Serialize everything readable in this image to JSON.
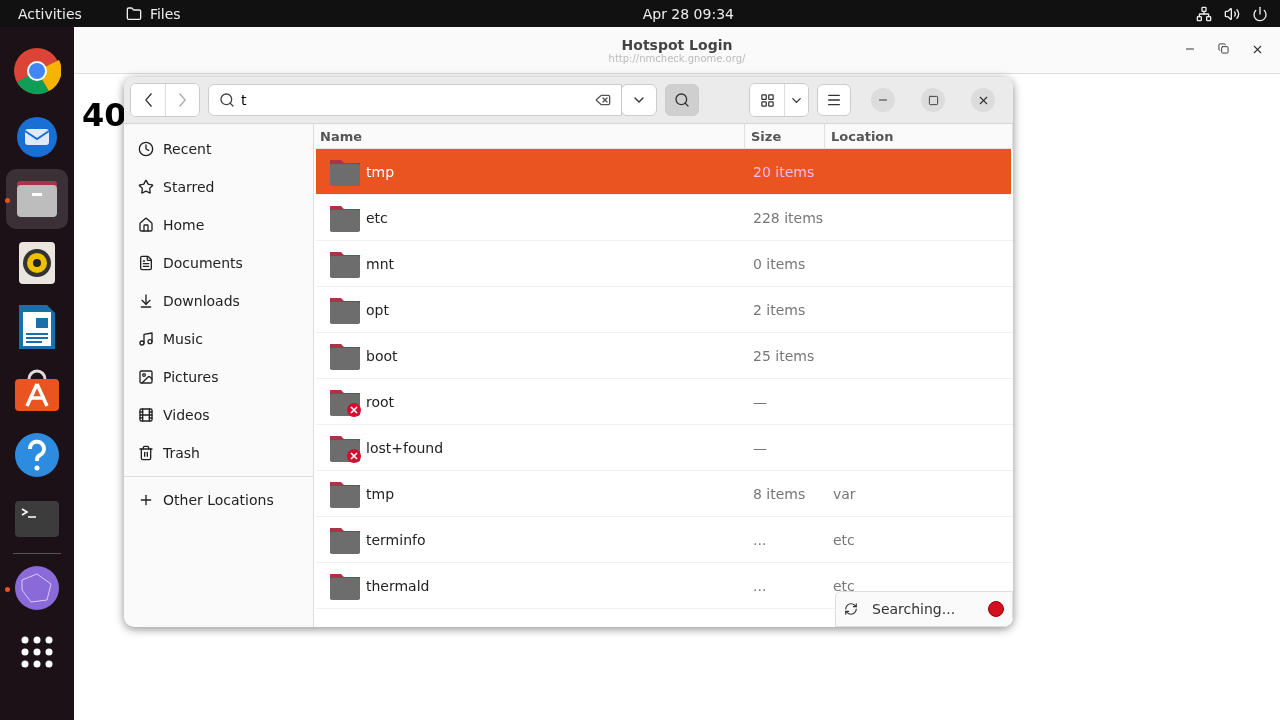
{
  "top_bar": {
    "activities": "Activities",
    "app": "Files",
    "clock": "Apr 28  09:34"
  },
  "dock": [
    {
      "kind": "chrome",
      "running": false,
      "active": false
    },
    {
      "kind": "mail",
      "running": false,
      "active": false
    },
    {
      "kind": "files",
      "running": true,
      "active": true
    },
    {
      "kind": "audio",
      "running": false,
      "active": false
    },
    {
      "kind": "writer",
      "running": false,
      "active": false
    },
    {
      "kind": "store",
      "running": false,
      "active": false
    },
    {
      "kind": "help",
      "running": false,
      "active": false
    },
    {
      "kind": "terminal",
      "running": false,
      "active": false
    },
    {
      "kind": "network",
      "running": true,
      "active": false
    },
    {
      "kind": "apps",
      "running": false,
      "active": false
    }
  ],
  "browser": {
    "title": "Hotspot Login",
    "url": "http://nmcheck.gnome.org/",
    "content": "40"
  },
  "files": {
    "search": {
      "value": "t"
    },
    "sidebar": {
      "items": [
        {
          "kind": "recent",
          "label": "Recent"
        },
        {
          "kind": "starred",
          "label": "Starred"
        },
        {
          "kind": "home",
          "label": "Home"
        },
        {
          "kind": "documents",
          "label": "Documents"
        },
        {
          "kind": "downloads",
          "label": "Downloads"
        },
        {
          "kind": "music",
          "label": "Music"
        },
        {
          "kind": "pictures",
          "label": "Pictures"
        },
        {
          "kind": "videos",
          "label": "Videos"
        },
        {
          "kind": "trash",
          "label": "Trash"
        }
      ],
      "other": {
        "label": "Other Locations"
      }
    },
    "table": {
      "columns": [
        "Name",
        "Size",
        "Location"
      ],
      "rows": [
        {
          "name": "tmp",
          "size": "20 items",
          "location": "",
          "selected": true,
          "locked": false
        },
        {
          "name": "etc",
          "size": "228 items",
          "location": "",
          "selected": false,
          "locked": false
        },
        {
          "name": "mnt",
          "size": "0 items",
          "location": "",
          "selected": false,
          "locked": false
        },
        {
          "name": "opt",
          "size": "2 items",
          "location": "",
          "selected": false,
          "locked": false
        },
        {
          "name": "boot",
          "size": "25 items",
          "location": "",
          "selected": false,
          "locked": false
        },
        {
          "name": "root",
          "size": "—",
          "location": "",
          "selected": false,
          "locked": true
        },
        {
          "name": "lost+found",
          "size": "—",
          "location": "",
          "selected": false,
          "locked": true
        },
        {
          "name": "tmp",
          "size": "8 items",
          "location": "var",
          "selected": false,
          "locked": false
        },
        {
          "name": "terminfo",
          "size": "...",
          "location": "etc",
          "selected": false,
          "locked": false
        },
        {
          "name": "thermald",
          "size": "...",
          "location": "etc",
          "selected": false,
          "locked": false
        }
      ]
    },
    "status": {
      "text": "Searching..."
    }
  }
}
